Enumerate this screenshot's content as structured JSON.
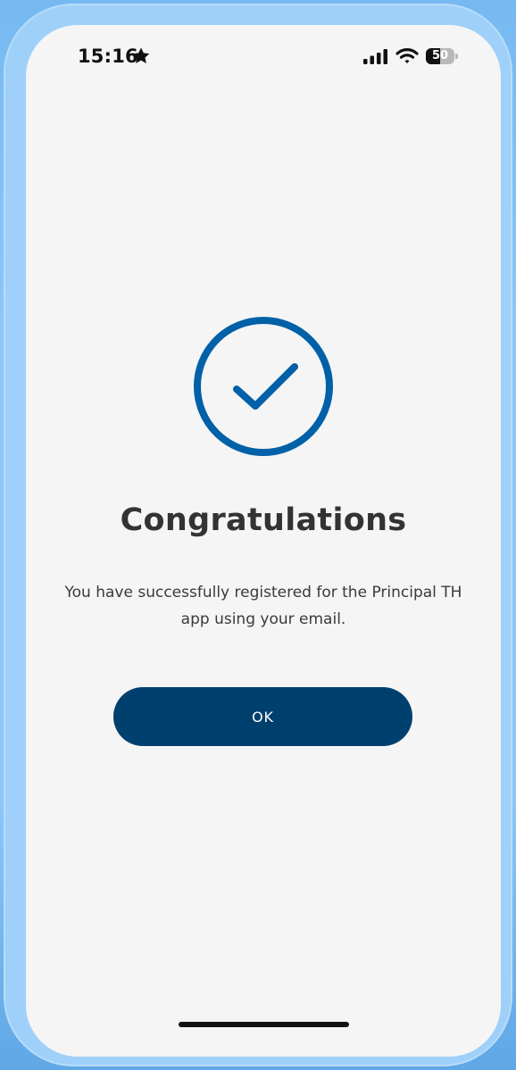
{
  "status_bar": {
    "time": "15:16",
    "battery_level": "50",
    "battery_fraction": 0.5,
    "icons": [
      "star-icon",
      "cellular-signal-icon",
      "wifi-icon",
      "battery-icon"
    ]
  },
  "success": {
    "icon": "success-check-icon",
    "title": "Congratulations",
    "message": "You have successfully registered for the Principal TH app using your email."
  },
  "actions": {
    "ok_label": "OK"
  },
  "colors": {
    "brand_blue": "#0060a8",
    "button_navy": "#00406f",
    "screen_background": "#f5f5f5",
    "title_text": "#333333"
  }
}
